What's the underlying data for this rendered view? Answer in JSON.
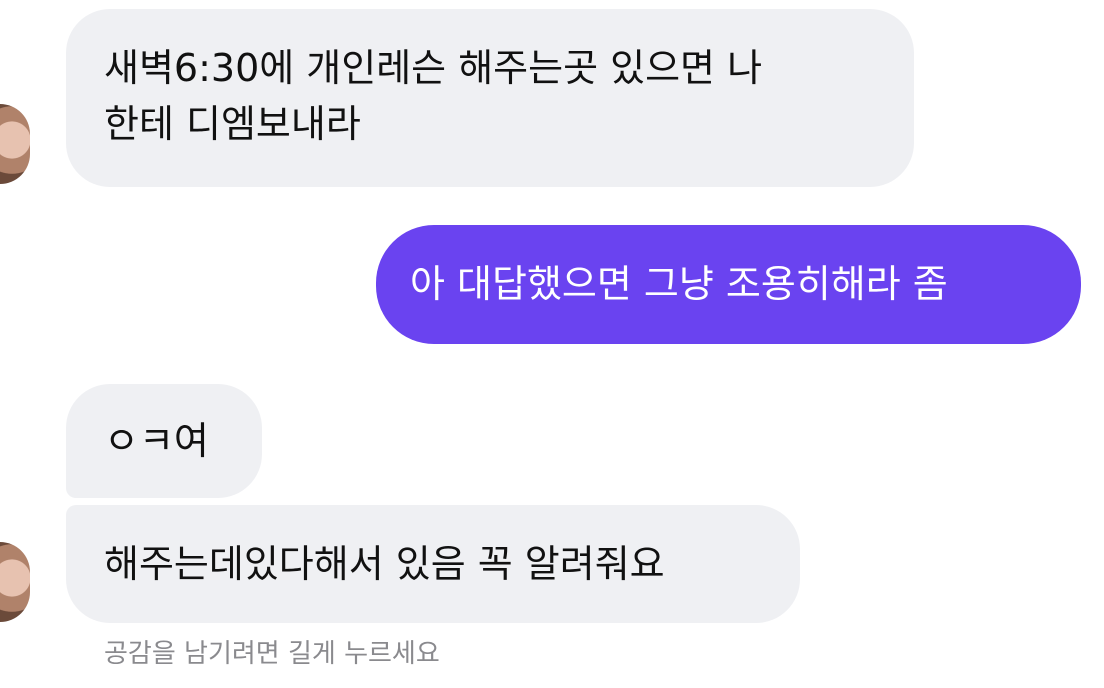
{
  "messages": [
    {
      "direction": "incoming",
      "text": "새벽6:30에 개인레슨 해주는곳 있으면 나\n한테 디엠보내라"
    },
    {
      "direction": "outgoing",
      "text": "아 대답했으면 그냥 조용히해라 좀"
    },
    {
      "direction": "incoming",
      "text": "ㅇㅋ여"
    },
    {
      "direction": "incoming",
      "text": "해주는데있다해서 있음 꼭 알려줘요"
    }
  ],
  "reaction_hint": "공감을 남기려면 길게 누르세요",
  "colors": {
    "incoming_bubble": "#eff0f3",
    "outgoing_bubble": "#6a43f0",
    "hint_text": "#8a8a8e"
  },
  "icons": {
    "avatar": "profile-photo-avatar"
  }
}
